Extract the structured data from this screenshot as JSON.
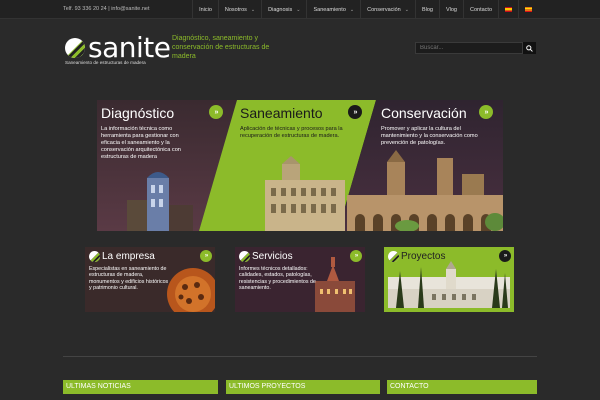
{
  "topbar": {
    "contact": "Telf. 93 336 20 24  |  info@sanite.net",
    "nav": [
      {
        "label": "Inicio",
        "dropdown": false
      },
      {
        "label": "Nosotros",
        "dropdown": true
      },
      {
        "label": "Diagnosis",
        "dropdown": true
      },
      {
        "label": "Saneamiento",
        "dropdown": true
      },
      {
        "label": "Conservación",
        "dropdown": true
      },
      {
        "label": "Blog",
        "dropdown": false
      },
      {
        "label": "Vlog",
        "dropdown": false
      },
      {
        "label": "Contacto",
        "dropdown": false
      }
    ],
    "chevron": "⌄",
    "languages": [
      {
        "code": "es",
        "icon": "spain-flag-icon"
      },
      {
        "code": "ca",
        "icon": "catalonia-flag-icon"
      }
    ]
  },
  "header": {
    "logo_text": "sanite",
    "logo_subtitle": "Saneamiento de estructuras de madera",
    "tagline": "Diagnóstico, saneamiento y conservación de estructuras de madera",
    "search_placeholder": "Buscar..."
  },
  "banner": {
    "diagnostico": {
      "title": "Diagnóstico",
      "text": "La información técnica como herramienta para gestionar con eficacia el saneamiento y la conservación arquitectónica con estructuras de madera"
    },
    "saneamiento": {
      "title": "Saneamiento",
      "text": "Aplicación de técnicas y procesos para la recuperación de estructuras de madera."
    },
    "conservacion": {
      "title": "Conservación",
      "text": "Promover y aplicar la cultura del mantenimiento y la conservación como prevención de patologías."
    },
    "arrow": "»"
  },
  "cards": [
    {
      "title": "La empresa",
      "text": "Especialistas en saneamiento de estructuras de madera, monumentos y edificios históricos y patrimonio cultural."
    },
    {
      "title": "Servicios",
      "text": "Informes técnicos  detallados: calidades, estados, patologías, resistencias y procedimientos de saneamiento."
    },
    {
      "title": "Proyectos",
      "text": ""
    }
  ],
  "footer": {
    "columns": [
      "ULTIMAS NOTICIAS",
      "ULTIMOS PROYECTOS",
      "CONTACTO"
    ]
  },
  "colors": {
    "accent": "#8cbb2a",
    "background": "#2a2a2a",
    "dark": "#1a1a1a"
  }
}
